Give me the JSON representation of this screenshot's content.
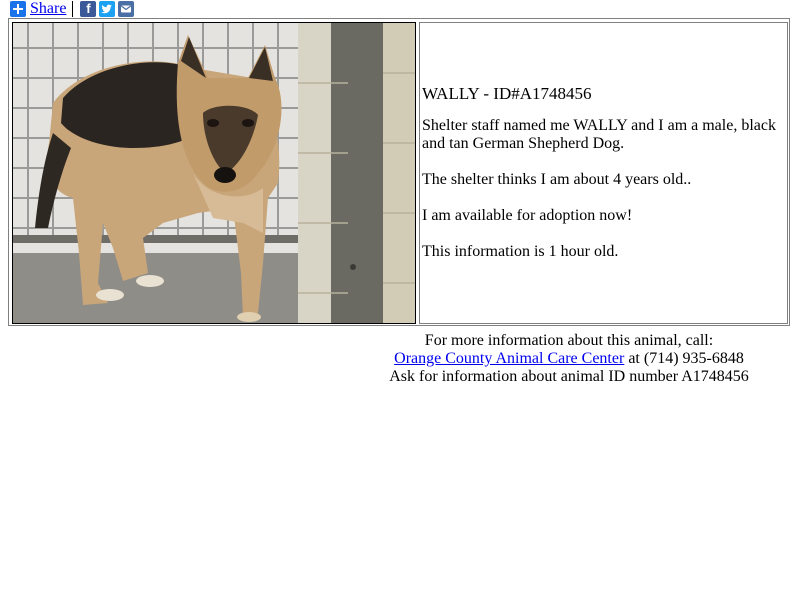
{
  "share": {
    "label": "Share",
    "icons": [
      "facebook-icon",
      "twitter-icon",
      "email-icon"
    ]
  },
  "pet": {
    "title": "WALLY - ID#A1748456",
    "paragraphs": [
      "Shelter staff named me WALLY and I am a male, black and tan German Shepherd Dog.",
      "The shelter thinks I am about 4 years old..",
      "I am available for adoption now!",
      "This information is 1 hour old."
    ]
  },
  "contact": {
    "line1": "For more information about this animal, call:",
    "shelter_name": "Orange County Animal Care Center",
    "phone_text": " at (714) 935-6848",
    "line3": "Ask for information about animal ID number A1748456"
  }
}
